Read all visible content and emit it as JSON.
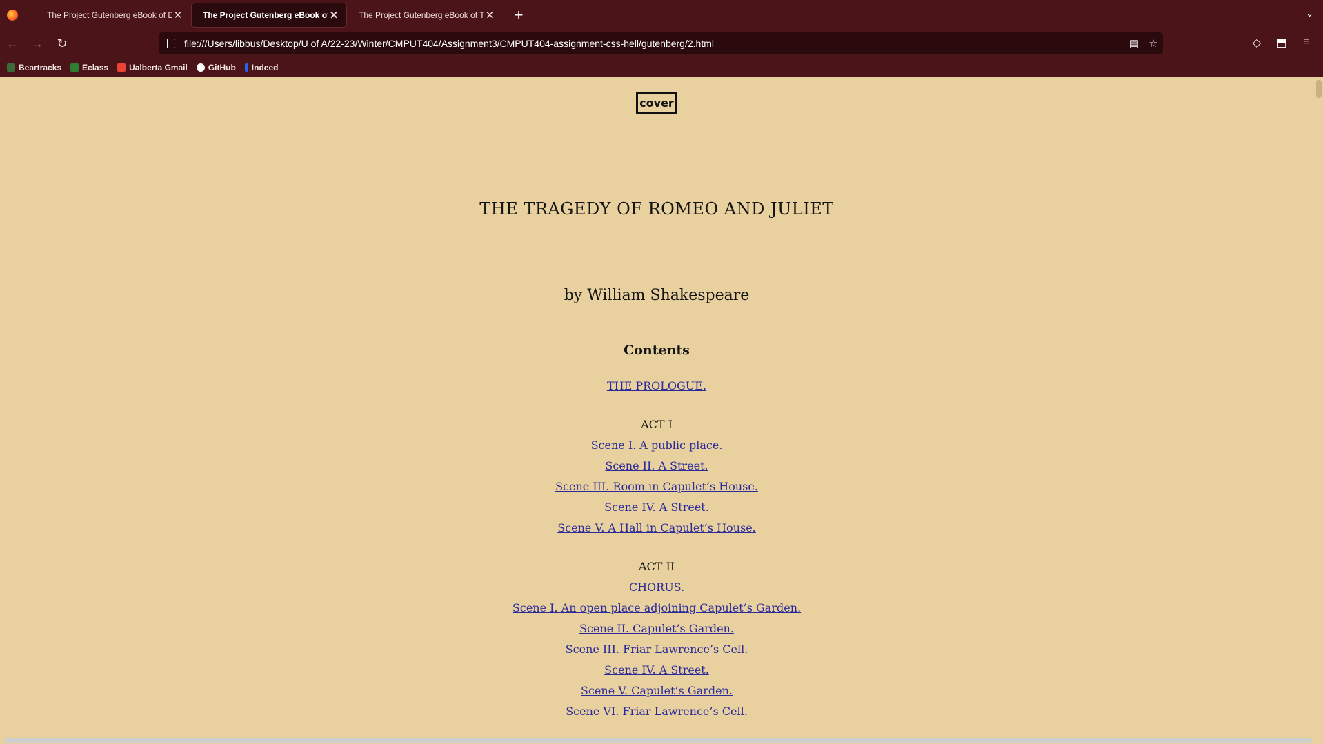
{
  "browser": {
    "tabs": [
      {
        "title": "The Project Gutenberg eBook of Dra",
        "active": false
      },
      {
        "title": "The Project Gutenberg eBook of Ro",
        "active": true
      },
      {
        "title": "The Project Gutenberg eBook of The",
        "active": false
      }
    ],
    "close_glyph": "✕",
    "new_tab_glyph": "+",
    "overflow_glyph": "⌄",
    "url": "file:///Users/libbus/Desktop/U of A/22-23/Winter/CMPUT404/Assignment3/CMPUT404-assignment-css-hell/gutenberg/2.html",
    "nav": {
      "back": "←",
      "forward": "→",
      "reload": "↻"
    },
    "url_actions": {
      "reader": "▤",
      "bookmark": "☆"
    },
    "tools": {
      "pocket": "◇",
      "extensions": "⬒",
      "menu": "≡"
    },
    "bookmarks": [
      {
        "label": "Beartracks",
        "icon": "beartracks-icon",
        "color": "#3b6b3b"
      },
      {
        "label": "Eclass",
        "icon": "eclass-icon",
        "color": "#2e7d32"
      },
      {
        "label": "Ualberta Gmail",
        "icon": "gmail-icon",
        "color": "#ea4335"
      },
      {
        "label": "GitHub",
        "icon": "github-icon",
        "color": "#ffffff"
      },
      {
        "label": "Indeed",
        "icon": "indeed-icon",
        "color": "#2164f3"
      }
    ]
  },
  "page": {
    "cover_label": "cover",
    "title": "THE TRAGEDY OF ROMEO AND JULIET",
    "author": "by William Shakespeare",
    "contents_heading": "Contents",
    "prologue": "THE PROLOGUE.",
    "acts": [
      {
        "label": "ACT I",
        "items": [
          "Scene I. A public place.",
          "Scene II. A Street.",
          "Scene III. Room in Capulet’s House.",
          "Scene IV. A Street.",
          "Scene V. A Hall in Capulet’s House."
        ]
      },
      {
        "label": "ACT II",
        "items": [
          "CHORUS.",
          "Scene I. An open place adjoining Capulet’s Garden.",
          "Scene II. Capulet’s Garden.",
          "Scene III. Friar Lawrence’s Cell.",
          "Scene IV. A Street.",
          "Scene V. Capulet’s Garden.",
          "Scene VI. Friar Lawrence’s Cell."
        ]
      }
    ]
  },
  "colors": {
    "chrome": "#4a1419",
    "page_background": "#e8d09f",
    "link": "#2a2a9a"
  }
}
